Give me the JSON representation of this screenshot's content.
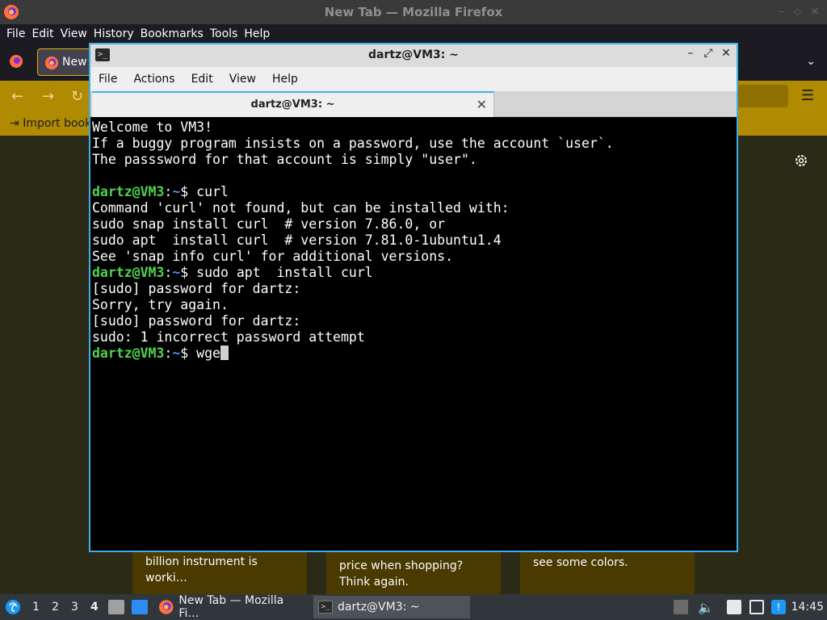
{
  "firefox": {
    "window_title": "New Tab — Mozilla Firefox",
    "menu": [
      "File",
      "Edit",
      "View",
      "History",
      "Bookmarks",
      "Tools",
      "Help"
    ],
    "tab_label": "New",
    "bookmarks_label": "Import book",
    "cards": [
      {
        "text": "billion instrument is worki…"
      },
      {
        "text": "price when shopping? Think again."
      },
      {
        "text": "see some colors."
      }
    ]
  },
  "terminal": {
    "window_title": "dartz@VM3: ~",
    "menu": [
      "File",
      "Actions",
      "Edit",
      "View",
      "Help"
    ],
    "tab_label": "dartz@VM3: ~",
    "tab_close_glyph": "✕",
    "prompt": {
      "user": "dartz@VM3",
      "colon": ":",
      "path": "~",
      "symbol": "$"
    },
    "lines": [
      {
        "type": "out",
        "text": "Welcome to VM3!"
      },
      {
        "type": "out",
        "text": "If a buggy program insists on a password, use the account `user`."
      },
      {
        "type": "out",
        "text": "The passsword for that account is simply \"user\"."
      },
      {
        "type": "out",
        "text": ""
      },
      {
        "type": "cmd",
        "text": "curl"
      },
      {
        "type": "out",
        "text": "Command 'curl' not found, but can be installed with:"
      },
      {
        "type": "out",
        "text": "sudo snap install curl  # version 7.86.0, or"
      },
      {
        "type": "out",
        "text": "sudo apt  install curl  # version 7.81.0-1ubuntu1.4"
      },
      {
        "type": "out",
        "text": "See 'snap info curl' for additional versions."
      },
      {
        "type": "cmd",
        "text": "sudo apt  install curl"
      },
      {
        "type": "out",
        "text": "[sudo] password for dartz:"
      },
      {
        "type": "out",
        "text": "Sorry, try again."
      },
      {
        "type": "out",
        "text": "[sudo] password for dartz:"
      },
      {
        "type": "out",
        "text": "sudo: 1 incorrect password attempt"
      },
      {
        "type": "cmd",
        "text": "wge",
        "cursor": true
      }
    ]
  },
  "taskbar": {
    "workspaces": [
      "1",
      "2",
      "3",
      "4"
    ],
    "active_workspace": "4",
    "tasks": [
      {
        "label": "New Tab — Mozilla Fi…",
        "icon": "firefox-icon"
      },
      {
        "label": "dartz@VM3: ~",
        "icon": "terminal-icon"
      }
    ],
    "clock": "14:45"
  }
}
